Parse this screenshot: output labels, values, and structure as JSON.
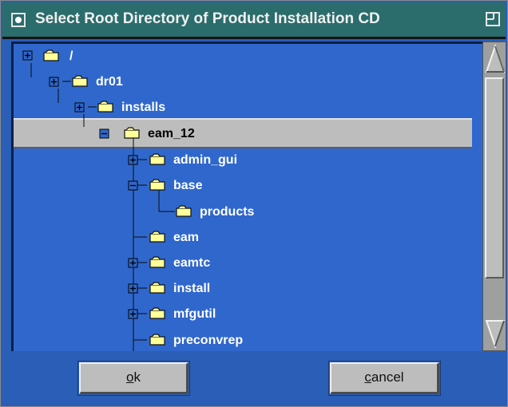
{
  "window": {
    "title": "Select Root Directory of Product Installation CD",
    "icons": [
      "window-menu-icon",
      "maximize-icon"
    ]
  },
  "tree": {
    "nodes": [
      {
        "label": "/",
        "expander": "plus"
      },
      {
        "label": "dr01",
        "expander": "plus"
      },
      {
        "label": "installs",
        "expander": "plus"
      },
      {
        "label": "eam_12",
        "expander": "minus",
        "selected": true
      },
      {
        "label": "admin_gui",
        "expander": "plus"
      },
      {
        "label": "base",
        "expander": "minus"
      },
      {
        "label": "products",
        "expander": "none"
      },
      {
        "label": "eam",
        "expander": "none"
      },
      {
        "label": "eamtc",
        "expander": "plus"
      },
      {
        "label": "install",
        "expander": "plus"
      },
      {
        "label": "mfgutil",
        "expander": "plus"
      },
      {
        "label": "preconvrep",
        "expander": "none"
      }
    ],
    "icon": "folder-icon"
  },
  "scrollbar": {
    "icons": [
      "scroll-up-arrow-icon",
      "scroll-down-arrow-icon"
    ]
  },
  "buttons": {
    "ok_label": "ok",
    "cancel_label": "cancel",
    "ok_mnemonic": "o",
    "ok_rest": "k",
    "cancel_mnemonic": "c",
    "cancel_rest": "ancel"
  },
  "colors": {
    "background": "#2a5eb7",
    "tree_background": "#2f67cc",
    "titlebar": "#2b6c6c",
    "selection": "#bdbdbd",
    "folder": "#ffff99"
  }
}
